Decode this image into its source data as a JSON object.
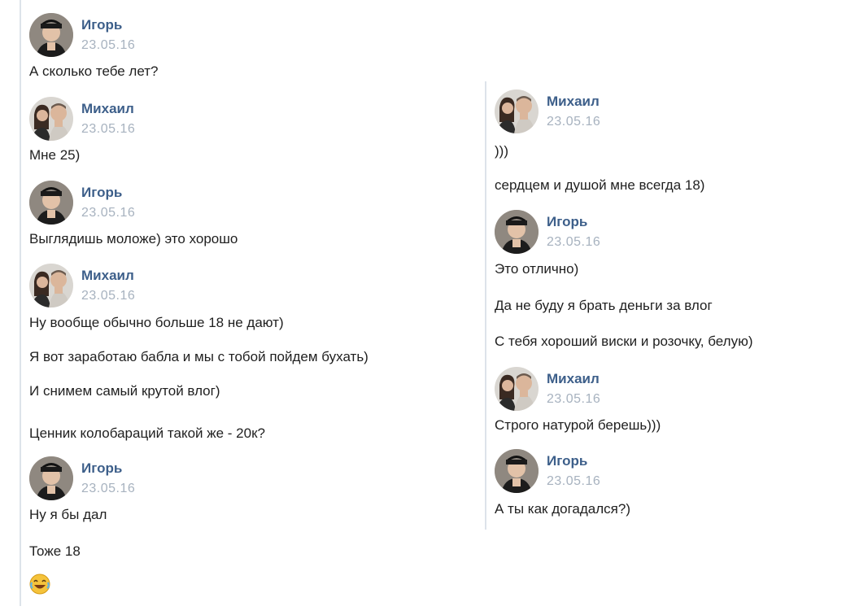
{
  "left": {
    "blocks": [
      {
        "author": "Игорь",
        "date": "23.05.16",
        "avatar": "igor",
        "messages": [
          "А сколько тебе лет?"
        ]
      },
      {
        "author": "Михаил",
        "date": "23.05.16",
        "avatar": "mikhail",
        "messages": [
          "Мне 25)"
        ]
      },
      {
        "author": "Игорь",
        "date": "23.05.16",
        "avatar": "igor",
        "messages": [
          "Выглядишь моложе) это хорошо"
        ]
      },
      {
        "author": "Михаил",
        "date": "23.05.16",
        "avatar": "mikhail",
        "messages": [
          "Ну вообще обычно больше 18 не дают)",
          "Я вот заработаю бабла и мы с тобой пойдем бухать)",
          "И снимем самый крутой влог)",
          "Ценник колобараций такой же - 20к?"
        ]
      },
      {
        "author": "Игорь",
        "date": "23.05.16",
        "avatar": "igor",
        "messages": [
          "Ну я бы дал",
          "Тоже 18"
        ],
        "emoji": "laughing-tears-emoji"
      }
    ]
  },
  "right": {
    "blocks": [
      {
        "author": "Михаил",
        "date": "23.05.16",
        "avatar": "mikhail",
        "messages": [
          ")))",
          "сердцем и душой мне всегда 18)"
        ]
      },
      {
        "author": "Игорь",
        "date": "23.05.16",
        "avatar": "igor",
        "messages": [
          "Это отлично)",
          "Да не буду я брать деньги за влог",
          "С тебя хороший виски и розочку, белую)"
        ]
      },
      {
        "author": "Михаил",
        "date": "23.05.16",
        "avatar": "mikhail",
        "messages": [
          "Строго натурой берешь)))"
        ]
      },
      {
        "author": "Игорь",
        "date": "23.05.16",
        "avatar": "igor",
        "messages": [
          "А ты как догадался?)"
        ]
      }
    ]
  },
  "colors": {
    "author": "#3d5f8a",
    "date": "#a7b2bf",
    "divider": "#dde3ea"
  }
}
